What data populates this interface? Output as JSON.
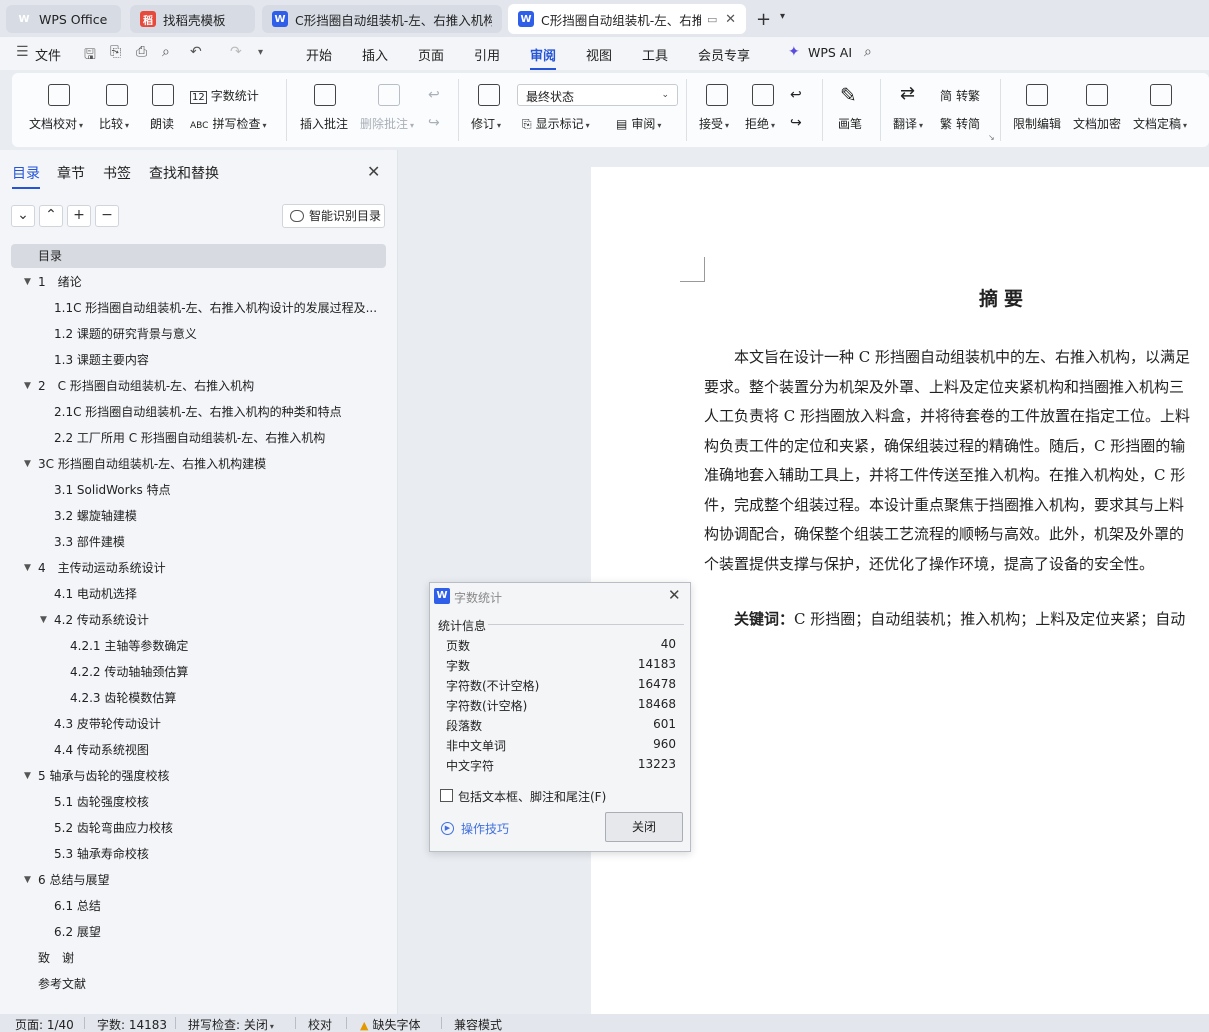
{
  "tabs": [
    {
      "label": "WPS Office",
      "icon": "wps-logo-icon"
    },
    {
      "label": "找稻壳模板",
      "icon": "docer-icon"
    },
    {
      "label": "C形挡圈自动组装机-左、右推入机构设",
      "icon": "word-doc-icon"
    },
    {
      "label": "C形挡圈自动组装机-左、右推...",
      "icon": "word-doc-icon",
      "active": true
    }
  ],
  "menubar": {
    "file": "文件",
    "items": [
      "开始",
      "插入",
      "页面",
      "引用",
      "审阅",
      "视图",
      "工具",
      "会员专享"
    ],
    "active": "审阅",
    "wps_ai": "WPS AI"
  },
  "ribbon": {
    "doc_check": "文档校对",
    "compare": "比较",
    "read_aloud": "朗读",
    "word_count": "字数统计",
    "spell_check": "拼写检查",
    "insert_comment": "插入批注",
    "delete_comment": "删除批注",
    "revise": "修订",
    "status_value": "最终状态",
    "show_marks": "显示标记",
    "review": "审阅",
    "accept": "接受",
    "reject": "拒绝",
    "pen": "画笔",
    "translate": "翻译",
    "to_traditional": "转繁",
    "to_simplified": "转简",
    "restrict_edit": "限制编辑",
    "encrypt": "文档加密",
    "finalize": "文档定稿"
  },
  "nav": {
    "tabs": [
      "目录",
      "章节",
      "书签",
      "查找和替换"
    ],
    "active_tab": "目录",
    "smart_toc": "智能识别目录",
    "toc": [
      {
        "text": "目录",
        "level": 0,
        "selected": true
      },
      {
        "text": "1　绪论",
        "level": 1,
        "expanded": true
      },
      {
        "text": "1.1C 形挡圈自动组装机-左、右推入机构设计的发展过程及...",
        "level": 2
      },
      {
        "text": "1.2 课题的研究背景与意义",
        "level": 2
      },
      {
        "text": "1.3 课题主要内容",
        "level": 2
      },
      {
        "text": "2　C 形挡圈自动组装机-左、右推入机构",
        "level": 1,
        "expanded": true
      },
      {
        "text": "2.1C 形挡圈自动组装机-左、右推入机构的种类和特点",
        "level": 2
      },
      {
        "text": "2.2 工厂所用 C 形挡圈自动组装机-左、右推入机构",
        "level": 2
      },
      {
        "text": "3C 形挡圈自动组装机-左、右推入机构建模",
        "level": 1,
        "expanded": true
      },
      {
        "text": "3.1 SolidWorks 特点",
        "level": 2
      },
      {
        "text": "3.2 螺旋轴建模",
        "level": 2
      },
      {
        "text": "3.3 部件建模",
        "level": 2
      },
      {
        "text": "4　主传动运动系统设计",
        "level": 1,
        "expanded": true
      },
      {
        "text": "4.1 电动机选择",
        "level": 2
      },
      {
        "text": "4.2 传动系统设计",
        "level": 2,
        "expanded": true
      },
      {
        "text": "4.2.1 主轴等参数确定",
        "level": 3
      },
      {
        "text": "4.2.2 传动轴轴颈估算",
        "level": 3
      },
      {
        "text": "4.2.3 齿轮模数估算",
        "level": 3
      },
      {
        "text": "4.3 皮带轮传动设计",
        "level": 2
      },
      {
        "text": "4.4 传动系统视图",
        "level": 2
      },
      {
        "text": "5 轴承与齿轮的强度校核",
        "level": 1,
        "expanded": true
      },
      {
        "text": "5.1 齿轮强度校核",
        "level": 2
      },
      {
        "text": "5.2 齿轮弯曲应力校核",
        "level": 2
      },
      {
        "text": "5.3 轴承寿命校核",
        "level": 2
      },
      {
        "text": "6 总结与展望",
        "level": 1,
        "expanded": true
      },
      {
        "text": "6.1 总结",
        "level": 2
      },
      {
        "text": "6.2 展望",
        "level": 2
      },
      {
        "text": "致　谢",
        "level": 0
      },
      {
        "text": "参考文献",
        "level": 0
      }
    ]
  },
  "document": {
    "title": "摘要",
    "lines": [
      "本文旨在设计一种 C 形挡圈自动组装机中的左、右推入机构，以满足",
      "要求。整个装置分为机架及外罩、上料及定位夹紧机构和挡圈推入机构三",
      "人工负责将 C 形挡圈放入料盒，并将待套卷的工件放置在指定工位。上料",
      "构负责工件的定位和夹紧，确保组装过程的精确性。随后，C 形挡圈的输",
      "准确地套入辅助工具上，并将工件传送至推入机构。在推入机构处，C 形",
      "件，完成整个组装过程。本设计重点聚焦于挡圈推入机构，要求其与上料",
      "构协调配合，确保整个组装工艺流程的顺畅与高效。此外，机架及外罩的",
      "个装置提供支撑与保护，还优化了操作环境，提高了设备的安全性。"
    ],
    "keywords_label": "关键词：",
    "keywords": "C 形挡圈；自动组装机；推入机构；上料及定位夹紧；自动"
  },
  "dialog": {
    "title": "字数统计",
    "section": "统计信息",
    "stats": [
      {
        "label": "页数",
        "value": "40"
      },
      {
        "label": "字数",
        "value": "14183"
      },
      {
        "label": "字符数(不计空格)",
        "value": "16478"
      },
      {
        "label": "字符数(计空格)",
        "value": "18468"
      },
      {
        "label": "段落数",
        "value": "601"
      },
      {
        "label": "非中文单词",
        "value": "960"
      },
      {
        "label": "中文字符",
        "value": "13223"
      }
    ],
    "checkbox_label": "包括文本框、脚注和尾注(F)",
    "tips": "操作技巧",
    "close": "关闭"
  },
  "statusbar": {
    "page": "页面: 1/40",
    "words": "字数: 14183",
    "spell": "拼写检查: 关闭",
    "proof": "校对",
    "missing_font": "缺失字体",
    "compat": "兼容模式"
  }
}
